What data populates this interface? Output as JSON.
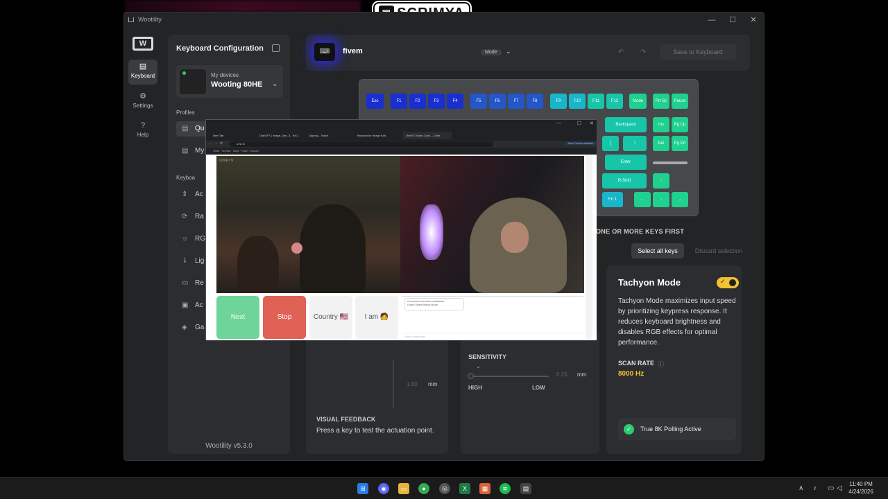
{
  "stream": {
    "brand": "SCRIMYA"
  },
  "window": {
    "title": "Wootility",
    "minimize": "—",
    "maximize": "☐",
    "close": "✕"
  },
  "nav": {
    "logo": "W",
    "items": [
      {
        "label": "Keyboard",
        "icon": "keyboard-icon",
        "glyph": "▤"
      },
      {
        "label": "Settings",
        "icon": "gear-icon",
        "glyph": "⚙"
      },
      {
        "label": "Help",
        "icon": "help-icon",
        "glyph": "?"
      }
    ]
  },
  "sidebar": {
    "title": "Keyboard Configuration",
    "device_label": "My devices",
    "device_name": "Wooting 80HE",
    "profiles_label": "Profiles",
    "profiles": [
      "Qu",
      "My"
    ],
    "keyboard_label": "Keyboa",
    "keyboard_items": [
      {
        "label": "Ac",
        "glyph": "⇕"
      },
      {
        "label": "Ra",
        "glyph": "⟳"
      },
      {
        "label": "RG",
        "glyph": "☼"
      },
      {
        "label": "Lig",
        "glyph": "⇂"
      },
      {
        "label": "Re",
        "glyph": "▭"
      },
      {
        "label": "Ac",
        "glyph": "▣"
      },
      {
        "label": "Ga",
        "glyph": "◈"
      }
    ],
    "version": "Wootility v5.3.0"
  },
  "topbar": {
    "profile_name": "fivem",
    "mode_label": "Mode",
    "undo": "↶",
    "redo": "↷",
    "save_label": "Save to Keyboard"
  },
  "keyboard": {
    "row1": [
      "Esc",
      "F1",
      "F2",
      "F3",
      "F4",
      "F5",
      "F6",
      "F7",
      "F8",
      "F9",
      "F10",
      "F11",
      "F12",
      "Mode",
      "Prt Sc",
      "Pause"
    ],
    "backspace": "Backspace",
    "ins": "Ins",
    "pgup": "Pg Up",
    "bracket": "]",
    "backslash": "\\",
    "del": "Del",
    "pgdn": "Pg Dn",
    "enter": "Enter",
    "rshift": "R-Shift",
    "up": "↑",
    "fn": "Fn 1",
    "left": "←",
    "down": "↓",
    "right": "→"
  },
  "selection": {
    "hint": "ONE OR MORE KEYS FIRST",
    "select_all": "Select all keys",
    "discard": "Discard selection"
  },
  "tachyon": {
    "title": "Tachyon Mode",
    "toggle_on": true,
    "description": "Tachyon Mode maximizes input speed by prioritizing keypress response. It reduces keyboard brightness and disables RGB effects for optimal performance.",
    "scan_label": "SCAN RATE",
    "scan_value": "8000 Hz",
    "polling": "True 8K Polling Active"
  },
  "actuation": {
    "value": "1.00",
    "unit": "mm",
    "vf_title": "VISUAL FEEDBACK",
    "vf_desc": "Press a key to test the actuation point."
  },
  "sensitivity": {
    "title": "SENSITIVITY",
    "value": "0.15",
    "unit": "mm",
    "high": "HIGH",
    "low": "LOW"
  },
  "overlay": {
    "tabs": [
      "New Tab",
      "ChatGPT | Image_Gen_3 - WO...",
      "Digi rsg - Twitch",
      "Request for Image Edit",
      "OmeTV Video Chat — Ome"
    ],
    "address": "ome.tv",
    "update": "New Chrome available",
    "bookmarks": "Gmail  ·  YouTube  ·  Maps  ·  Twitch  ·  Discord",
    "logo": "OmeTV",
    "buttons": {
      "next": "Next",
      "stop": "Stop",
      "country": "Country 🇺🇸",
      "iam": "I am 🧑"
    },
    "chat_msg_1": "Connection has been established.",
    "chat_msg_2": "United States  Report abuse",
    "chat_placeholder": "Write a message"
  },
  "taskbar": {
    "time": "11:40 PM",
    "date": "4/24/2026",
    "chevron": "∧"
  },
  "colors": {
    "accent": "#f2c230",
    "green": "#2ecc71",
    "key_blue": "#1a2fd0",
    "key_cyan": "#19b6c9",
    "key_green": "#1fd08e"
  }
}
